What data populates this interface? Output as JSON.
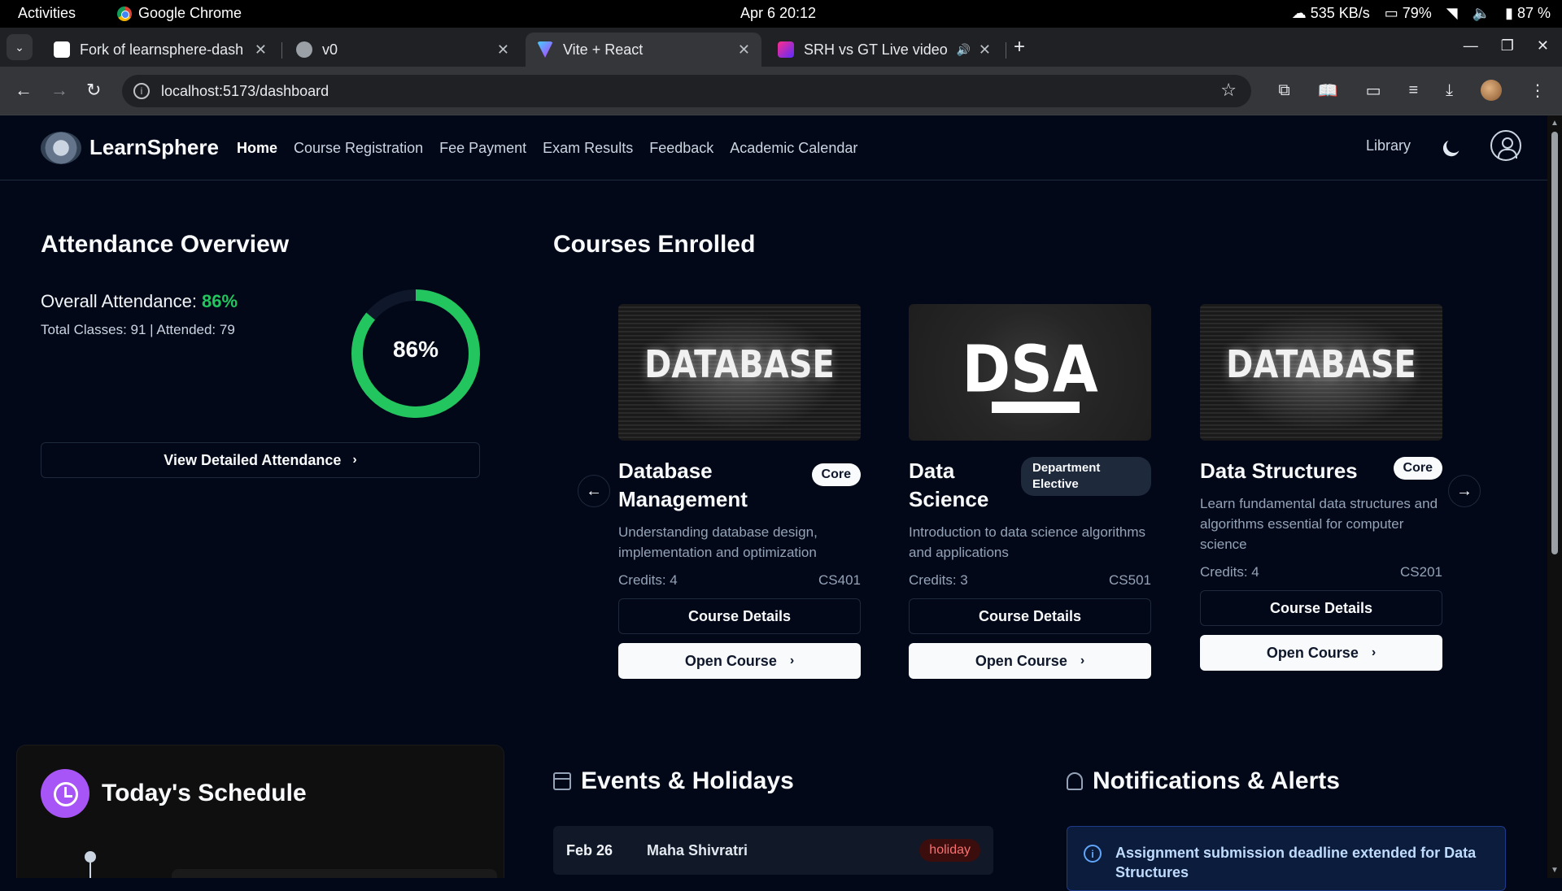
{
  "os": {
    "activities": "Activities",
    "app_name": "Google Chrome",
    "clock": "Apr 6  20:12",
    "net_speed": "535 KB/s",
    "cpu": "79%",
    "battery": "87 %"
  },
  "browser": {
    "tabs": [
      {
        "title": "Fork of learnsphere-dash"
      },
      {
        "title": "v0"
      },
      {
        "title": "Vite + React"
      },
      {
        "title": "SRH vs GT Live video"
      }
    ],
    "url": "localhost:5173/dashboard"
  },
  "navbar": {
    "brand": "LearnSphere",
    "links": [
      "Home",
      "Course Registration",
      "Fee Payment",
      "Exam Results",
      "Feedback",
      "Academic Calendar"
    ],
    "library": "Library"
  },
  "attendance": {
    "title": "Attendance Overview",
    "overall_label": "Overall Attendance:",
    "overall_value": "86%",
    "percent": 86,
    "summary": "Total Classes: 91 | Attended: 79",
    "button": "View Detailed Attendance",
    "ring_color": "#22c55e"
  },
  "courses": {
    "title": "Courses Enrolled",
    "items": [
      {
        "image_text": "DATABASE",
        "name": "Database Management",
        "badge": "Core",
        "description": "Understanding database design, implementation and optimization",
        "credits": "Credits: 4",
        "code": "CS401",
        "details_btn": "Course Details",
        "open_btn": "Open Course"
      },
      {
        "image_text": "DSA",
        "name": "Data Science",
        "badge": "Department Elective",
        "description": "Introduction to data science algorithms and applications",
        "credits": "Credits: 3",
        "code": "CS501",
        "details_btn": "Course Details",
        "open_btn": "Open Course"
      },
      {
        "image_text": "DATABASE",
        "name": "Data Structures",
        "badge": "Core",
        "description": "Learn fundamental data structures and algorithms essential for computer science",
        "credits": "Credits: 4",
        "code": "CS201",
        "details_btn": "Course Details",
        "open_btn": "Open Course"
      }
    ]
  },
  "schedule": {
    "title": "Today's Schedule",
    "accent": "#a855f7"
  },
  "events": {
    "title": "Events & Holidays",
    "items": [
      {
        "date": "Feb 26",
        "name": "Maha Shivratri",
        "tag": "holiday"
      }
    ]
  },
  "notifications": {
    "title": "Notifications & Alerts",
    "items": [
      {
        "text": "Assignment submission deadline extended for Data Structures"
      }
    ]
  }
}
